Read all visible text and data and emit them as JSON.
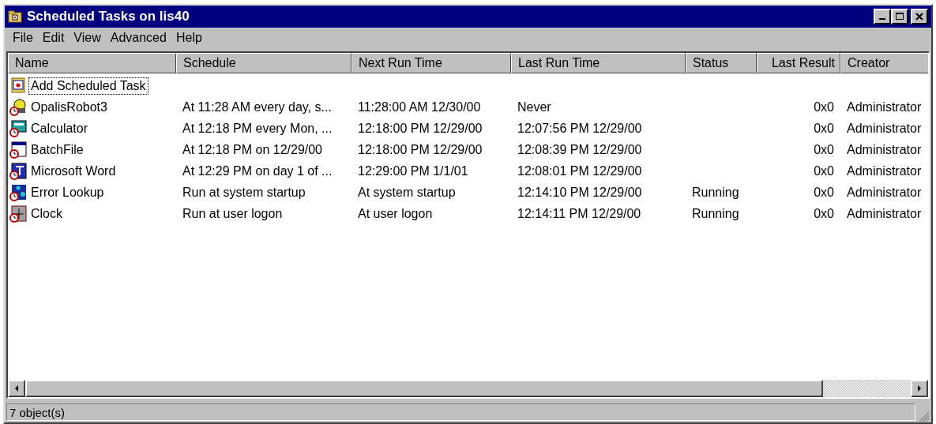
{
  "window": {
    "title": "Scheduled Tasks on lis40"
  },
  "menu": [
    "File",
    "Edit",
    "View",
    "Advanced",
    "Help"
  ],
  "table": {
    "columns": [
      "Name",
      "Schedule",
      "Next Run Time",
      "Last Run Time",
      "Status",
      "Last Result",
      "Creator"
    ],
    "rows": [
      {
        "kind": "add",
        "focused": true,
        "cells": [
          "Add Scheduled Task"
        ]
      },
      {
        "kind": "robot",
        "focused": false,
        "cells": [
          "OpalisRobot3",
          "At 11:28 AM every day, s...",
          "11:28:00 AM  12/30/00",
          "Never",
          "",
          "0x0",
          "Administrator"
        ]
      },
      {
        "kind": "calculator",
        "focused": false,
        "cells": [
          "Calculator",
          "At 12:18 PM every Mon, ...",
          "12:18:00 PM  12/29/00",
          "12:07:56 PM  12/29/00",
          "",
          "0x0",
          "Administrator"
        ]
      },
      {
        "kind": "batch",
        "focused": false,
        "cells": [
          "BatchFile",
          "At 12:18 PM on 12/29/00",
          "12:18:00 PM  12/29/00",
          "12:08:39 PM  12/29/00",
          "",
          "0x0",
          "Administrator"
        ]
      },
      {
        "kind": "word",
        "focused": false,
        "cells": [
          "Microsoft Word",
          "At 12:29 PM on day 1 of ...",
          "12:29:00 PM  1/1/01",
          "12:08:01 PM  12/29/00",
          "",
          "0x0",
          "Administrator"
        ]
      },
      {
        "kind": "lookup",
        "focused": false,
        "cells": [
          "Error Lookup",
          "Run at system startup",
          "At system startup",
          "12:14:10 PM  12/29/00",
          "Running",
          "0x0",
          "Administrator"
        ]
      },
      {
        "kind": "clock",
        "focused": false,
        "cells": [
          "Clock",
          "Run at user logon",
          "At user logon",
          "12:14:11 PM  12/29/00",
          "Running",
          "0x0",
          "Administrator"
        ]
      }
    ]
  },
  "status_bar": "7 object(s)"
}
